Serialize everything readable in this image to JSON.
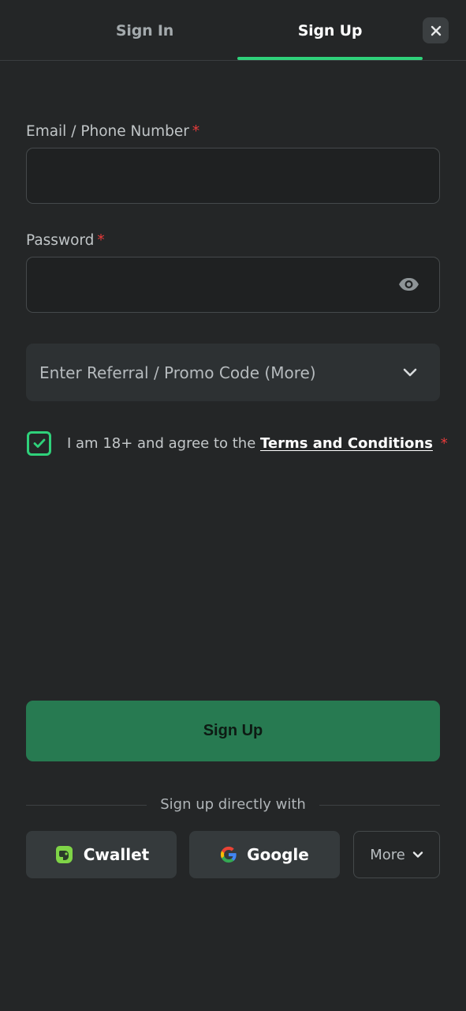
{
  "tabs": {
    "sign_in": "Sign In",
    "sign_up": "Sign Up",
    "active": "sign_up"
  },
  "form": {
    "email_label": "Email / Phone Number",
    "email_value": "",
    "password_label": "Password",
    "password_value": "",
    "required_mark": "*",
    "promo_label": "Enter Referral / Promo Code (More)",
    "agree_prefix": "I am 18+ and agree to the",
    "agree_link": "Terms and Conditions",
    "agree_checked": true,
    "submit_label": "Sign Up"
  },
  "social": {
    "divider_text": "Sign up directly with",
    "cwallet_label": "Cwallet",
    "google_label": "Google",
    "more_label": "More"
  },
  "colors": {
    "background": "#242627",
    "accent_green": "#2fd17a",
    "submit_button": "#277a51",
    "required_red": "#e83b3b"
  },
  "icons": [
    "close-icon",
    "eye-icon",
    "chevron-down-icon",
    "check-icon",
    "cwallet-icon",
    "google-icon"
  ]
}
